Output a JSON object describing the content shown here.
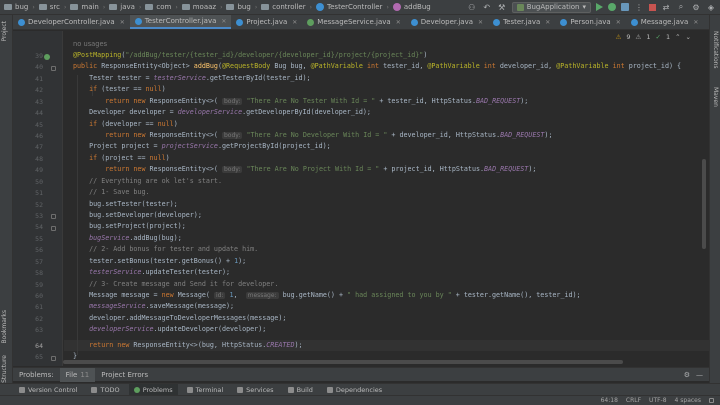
{
  "breadcrumb": [
    "bug",
    "src",
    "main",
    "java",
    "com",
    "moaaz",
    "bug",
    "controller",
    "TesterController",
    "addBug"
  ],
  "run_config": "BugApplication",
  "tabs": [
    {
      "label": "DeveloperController.java",
      "kind": "class"
    },
    {
      "label": "TesterController.java",
      "kind": "class",
      "active": true
    },
    {
      "label": "Project.java",
      "kind": "class"
    },
    {
      "label": "MessageService.java",
      "kind": "interface"
    },
    {
      "label": "Developer.java",
      "kind": "class"
    },
    {
      "label": "Tester.java",
      "kind": "class"
    },
    {
      "label": "Person.java",
      "kind": "class"
    },
    {
      "label": "Message.java",
      "kind": "class"
    }
  ],
  "inspections": {
    "warnings": "9",
    "weak": "1",
    "ok": "1"
  },
  "left_tool_windows": [
    "Project",
    "Bookmarks",
    "Structure"
  ],
  "right_tool_windows": [
    "Notifications",
    "Maven"
  ],
  "usage_hint": "no usages",
  "line_numbers": [
    "39",
    "40",
    "41",
    "42",
    "43",
    "44",
    "45",
    "46",
    "47",
    "48",
    "49",
    "50",
    "51",
    "52",
    "53",
    "54",
    "55",
    "56",
    "57",
    "58",
    "59",
    "60",
    "61",
    "62",
    "63",
    "64",
    "65"
  ],
  "current_line": "64",
  "problems": {
    "label": "Problems:",
    "file_tab": "File",
    "file_count": "11",
    "project_errors": "Project Errors"
  },
  "bottom_tools": [
    "Version Control",
    "TODO",
    "Problems",
    "Terminal",
    "Services",
    "Build",
    "Dependencies"
  ],
  "status": {
    "position": "64:18",
    "line_sep": "CRLF",
    "encoding": "UTF-8",
    "indent": "4 spaces"
  },
  "colors": {
    "keyword": "#cc7832",
    "string": "#6a8759",
    "annotation": "#bbb529",
    "field": "#9876aa",
    "comment": "#808080",
    "accent": "#4a88c7"
  }
}
